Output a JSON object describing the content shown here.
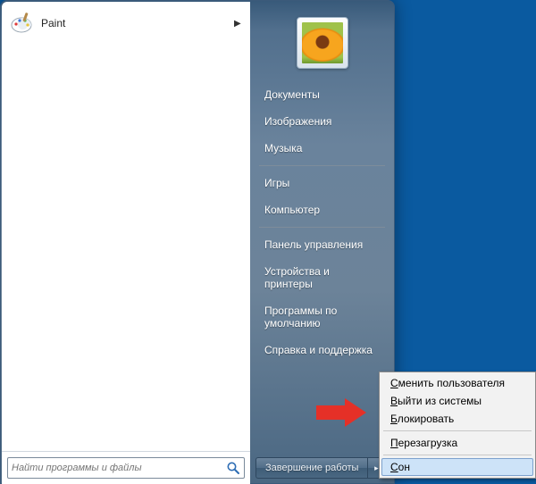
{
  "left": {
    "programs": [
      {
        "label": "Paint",
        "icon": "paint-icon",
        "has_submenu": true
      }
    ],
    "search": {
      "placeholder": "Найти программы и файлы"
    }
  },
  "right": {
    "items_block1": [
      "Документы",
      "Изображения",
      "Музыка"
    ],
    "items_block2": [
      "Игры",
      "Компьютер"
    ],
    "items_block3": [
      "Панель управления",
      "Устройства и принтеры",
      "Программы по умолчанию",
      "Справка и поддержка"
    ]
  },
  "shutdown": {
    "label": "Завершение работы",
    "arrow": "▸",
    "submenu": [
      {
        "text": "Сменить пользователя",
        "underline_index": 0
      },
      {
        "text": "Выйти из системы",
        "underline_index": 0
      },
      {
        "text": "Блокировать",
        "underline_index": 0
      },
      "---",
      {
        "text": "Перезагрузка",
        "underline_index": 0
      },
      "---",
      {
        "text": "Сон",
        "underline_index": 0,
        "highlight": true
      }
    ]
  },
  "annotation": {
    "arrow_color": "#e53027"
  }
}
